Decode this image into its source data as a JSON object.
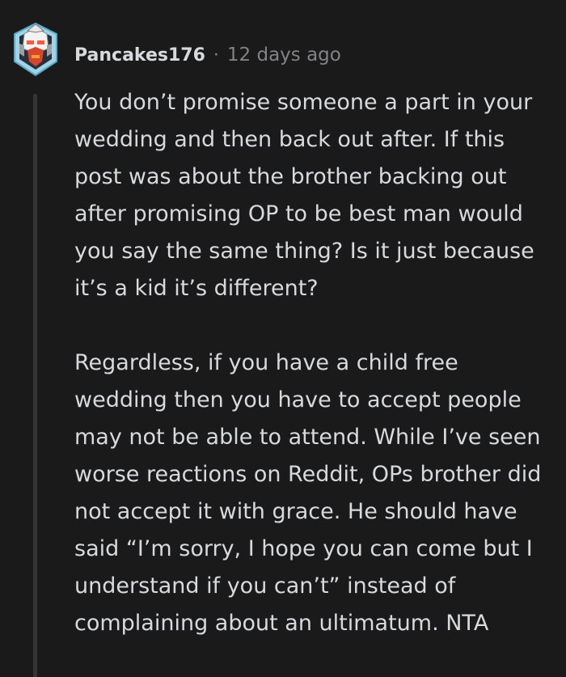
{
  "comment": {
    "author": "Pancakes176",
    "separator": "·",
    "timestamp": "12 days ago",
    "avatar_icon": "robot-avatar-icon",
    "paragraphs": [
      "You don’t promise someone a part in your wedding and then back out after. If this post was about the brother backing out after promising OP to be best man would you say the same thing? Is it just because it’s a kid it’s different?",
      "Regardless, if you have a child free wedding then you have to accept people may not be able to attend. While I’ve seen worse reactions on Reddit, OPs brother did not accept it with grace. He should have said “I’m sorry, I hope you can come but I understand if you can’t” instead of complaining about an ultimatum. NTA"
    ]
  },
  "colors": {
    "background": "#1a1a1b",
    "text": "#d7dadc",
    "muted": "#818384",
    "thread_line": "#343536"
  }
}
